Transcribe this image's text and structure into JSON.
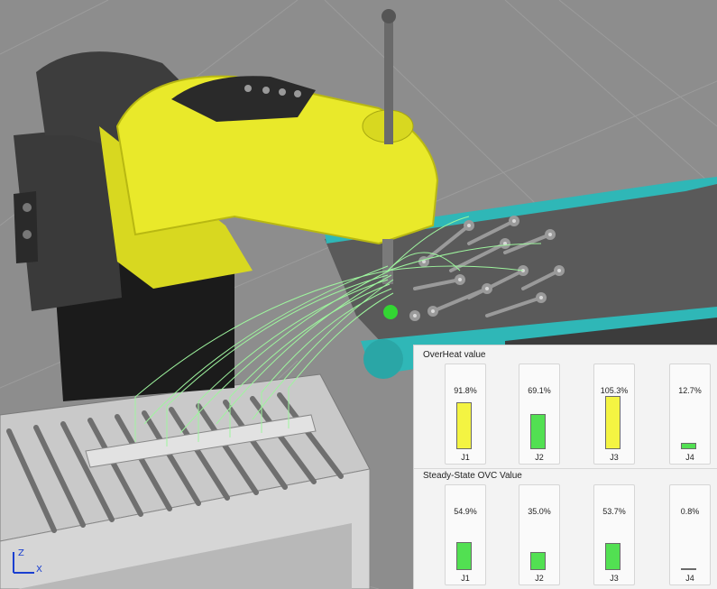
{
  "viewport": {
    "axis_labels": {
      "z": "Z",
      "x": "X"
    }
  },
  "panel": {
    "overheat": {
      "title": "OverHeat value",
      "joints": [
        {
          "label": "J1",
          "value_text": "91.8%",
          "value": 91.8,
          "color": "#f4f442"
        },
        {
          "label": "J2",
          "value_text": "69.1%",
          "value": 69.1,
          "color": "#52e052"
        },
        {
          "label": "J3",
          "value_text": "105.3%",
          "value": 105.3,
          "color": "#f4f442"
        },
        {
          "label": "J4",
          "value_text": "12.7%",
          "value": 12.7,
          "color": "#52e052"
        }
      ]
    },
    "ovc": {
      "title": "Steady-State OVC Value",
      "joints": [
        {
          "label": "J1",
          "value_text": "54.9%",
          "value": 54.9,
          "color": "#52e052"
        },
        {
          "label": "J2",
          "value_text": "35.0%",
          "value": 35.0,
          "color": "#52e052"
        },
        {
          "label": "J3",
          "value_text": "53.7%",
          "value": 53.7,
          "color": "#52e052"
        },
        {
          "label": "J4",
          "value_text": "0.8%",
          "value": 0.8,
          "color": "#52e052"
        }
      ]
    }
  }
}
